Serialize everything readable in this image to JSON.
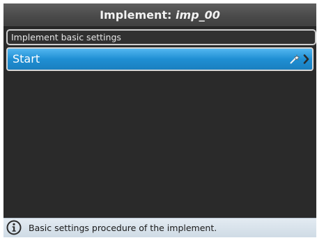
{
  "header": {
    "title_prefix": "Implement: ",
    "title_name": "imp_00"
  },
  "section": {
    "label": "Implement basic settings"
  },
  "items": [
    {
      "label": "Start",
      "icons": [
        "wand-icon",
        "chevron-right-icon"
      ]
    }
  ],
  "status": {
    "icon": "info-icon",
    "text": "Basic settings procedure of the implement."
  },
  "colors": {
    "accent": "#1f8fd3",
    "background": "#2a2a2a",
    "status_bar": "#d9e3eb"
  }
}
